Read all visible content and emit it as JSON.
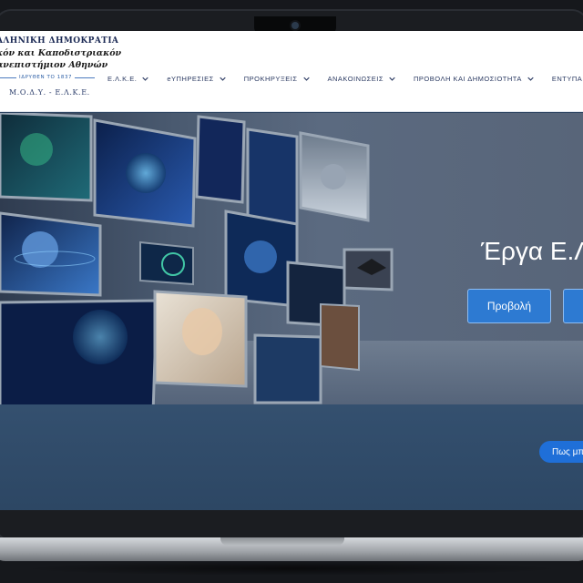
{
  "logo": {
    "line1": "ΛΛΗΝΙΚΗ ΔΗΜΟΚΡΑΤΙΑ",
    "line2": "κόν και Καποδιστριακόν",
    "line3": "ανεπιστήμιον Αθηνών",
    "founded": "ΙΔΡΥΘΕΝ ΤΟ 1837",
    "org": "Μ.Ο.Δ.Υ. - Ε.Λ.Κ.Ε."
  },
  "nav": {
    "items": [
      {
        "label": "Ε.Λ.Κ.Ε.",
        "has_dropdown": true
      },
      {
        "label": "eΥΠΗΡΕΣΙΕΣ",
        "has_dropdown": true
      },
      {
        "label": "ΠΡΟΚΗΡΥΞΕΙΣ",
        "has_dropdown": true
      },
      {
        "label": "ΑΝΑΚΟΙΝΩΣΕΙΣ",
        "has_dropdown": true
      },
      {
        "label": "ΠΡΟΒΟΛΗ ΚΑΙ ΔΗΜΟΣΙΟΤΗΤΑ",
        "has_dropdown": true
      },
      {
        "label": "ΕΝΤΥΠΑ",
        "has_dropdown": false
      }
    ]
  },
  "hero": {
    "title": "Έργα Ε.Λ",
    "view_button": "Προβολή"
  },
  "help": {
    "pill_label": "Πως μπ"
  },
  "colors": {
    "accent_blue": "#2d7ad2",
    "nav_text": "#2b3a62",
    "band_blue": "#2f4663"
  }
}
